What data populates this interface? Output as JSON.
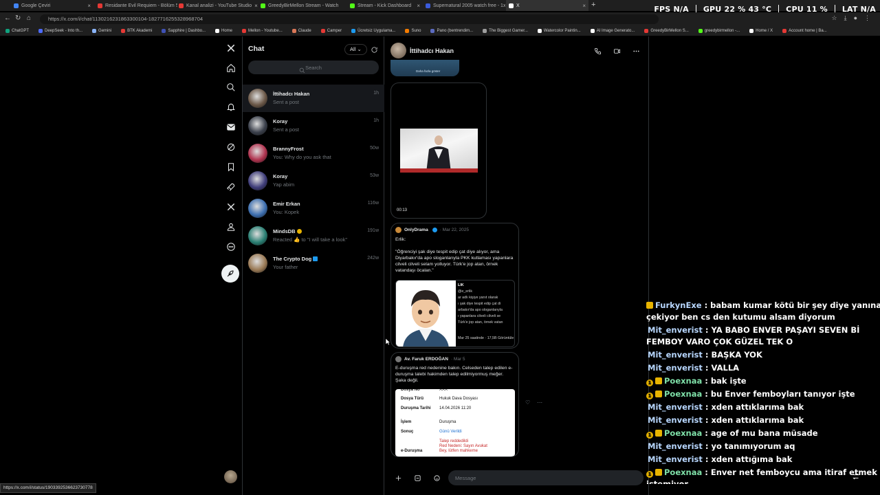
{
  "browser": {
    "tabs": [
      {
        "title": "Google Çeviri",
        "color": "#4285f4",
        "close": "×"
      },
      {
        "title": "Residante Evil Requiem - Bölüm 5",
        "color": "#e53935",
        "close": "×"
      },
      {
        "title": "Kanal analizi - YouTube Studio",
        "color": "#e53935",
        "close": "×"
      },
      {
        "title": "GreedyBirMellon Stream - Watch",
        "color": "#53fc18",
        "close": "×"
      },
      {
        "title": "Stream - Kick Dashboard",
        "color": "#53fc18",
        "close": "×"
      },
      {
        "title": "Supernatural 2005 watch free - 1x",
        "color": "#3b5bdb",
        "close": "×"
      },
      {
        "title": "X",
        "color": "#ffffff",
        "close": "×"
      }
    ],
    "new_tab": "+",
    "url": "https://x.com/i/chat/1130216231863300104-1827716255328968704",
    "bookmarks": [
      {
        "label": "ChatGPT",
        "color": "#10a37f"
      },
      {
        "label": "DeepSeek - Into th...",
        "color": "#4d6bfe"
      },
      {
        "label": "Gemini",
        "color": "#8ab4f8"
      },
      {
        "label": "BTK Akademi",
        "color": "#e53935"
      },
      {
        "label": "Sapphire | Dashbo...",
        "color": "#3f51b5"
      },
      {
        "label": "Home",
        "color": "#ffffff"
      },
      {
        "label": "Mellon - Youtube...",
        "color": "#e53935"
      },
      {
        "label": "Claude",
        "color": "#d97757"
      },
      {
        "label": "Camper",
        "color": "#e53935"
      },
      {
        "label": "Ücretsiz Uygulama...",
        "color": "#1d9bf0"
      },
      {
        "label": "Suno",
        "color": "#f57c00"
      },
      {
        "label": "Pano (bentrendim...",
        "color": "#5c6bc0"
      },
      {
        "label": "The Biggest Gamer...",
        "color": "#9e9e9e"
      },
      {
        "label": "Watercolor Paintin...",
        "color": "#ffffff"
      },
      {
        "label": "AI Image Generato...",
        "color": "#ffffff"
      },
      {
        "label": "GreedyBirMellon S...",
        "color": "#e53935"
      },
      {
        "label": "greedybirmellon -...",
        "color": "#53fc18"
      },
      {
        "label": "Home / X",
        "color": "#ffffff"
      },
      {
        "label": "Account home | Ba...",
        "color": "#e53935"
      }
    ]
  },
  "hud": {
    "fps_label": "FPS",
    "fps_value": "N/A",
    "gpu_label": "GPU",
    "gpu_value": "22 % 43 °C",
    "cpu_label": "CPU",
    "cpu_value": "11 %",
    "lat_label": "LAT",
    "lat_value": "N/A"
  },
  "chat": {
    "title": "Chat",
    "filter": "All",
    "search_placeholder": "Search",
    "conversations": [
      {
        "name": "İttihadcı Hakan",
        "preview": "Sent a post",
        "time": "1h",
        "avatar": "#6b5848"
      },
      {
        "name": "Koray",
        "preview": "Sent a post",
        "time": "1h",
        "avatar": "#3a3f4a"
      },
      {
        "name": "BrannyFrost",
        "preview": "You: Why do you ask that",
        "time": "50w",
        "avatar": "#b0334f"
      },
      {
        "name": "Koray",
        "preview": "Yap abim",
        "time": "53w",
        "avatar": "#3f3d7a"
      },
      {
        "name": "Emir Erkan",
        "preview": "You: Kopek",
        "time": "116w",
        "avatar": "#3d6fb0"
      },
      {
        "name": "MindsDB",
        "preview": "Reacted 👍 to \"I will take a look\"",
        "time": "191w",
        "avatar": "#2a7f73"
      },
      {
        "name": "The Crypto Dog",
        "preview": "Your father",
        "time": "242w",
        "avatar": "#9a7a56"
      }
    ]
  },
  "conversation": {
    "name": "İttihadcı Hakan",
    "quoted_card_button": "Daha fazla göster",
    "video_time": "00:13",
    "tweet1": {
      "author": "OnlyDrama",
      "date": "Mar 22, 2025",
      "text": "Erlik:\n\n\"Öğrenciyi şak diye tespit edip çat diye alıyor, ama Diyarbakır'da apo sloganlarıyla PKK kutlaması yapanlara cilveli cilveli selam yolluyor. Türk'e jop atan, örnek vatandaşı öcalan.\"",
      "quote_lines": [
        "LIK",
        "@e_erlik",
        "ar adlı kişiye yanıt olarak",
        "ı şak diye tespit edip çat di",
        "arbakır'da apo sloganlarıyla",
        "ı yapanlara cilveli cilveli se",
        "Türk'e jop atan, örnek vatan",
        "Mar 25 saatinde · 17,5B Görüntüle"
      ]
    },
    "tweet2": {
      "author": "Av. Faruk ERDOĞAN",
      "date": "Mar 5",
      "text": "E-duruşma red nedenine bakın. Celseden talep edilen e-duruşma talebi hakimden talep edilmiyormuş meğer. Şaka değil.",
      "doc": [
        {
          "k": "Dosya No",
          "v": "XXX"
        },
        {
          "k": "Dosya Türü",
          "v": "Hukuk Dava Dosyası"
        },
        {
          "k": "Duruşma Tarihi",
          "v": "14.04.2026 11:20"
        },
        {
          "k": "İşlem",
          "v": "Duruşma"
        },
        {
          "k": "Sonuç",
          "v": "Günü Verildi"
        },
        {
          "k": "e-Duruşma",
          "v": "Talep reddedildi",
          "v2": "Red Nedeni: Sayın Avukat",
          "v3": "Bey, lütfen mahkeme"
        }
      ]
    },
    "message_placeholder": "Message"
  },
  "kick_chat": [
    {
      "user": "FurkynExe",
      "text": ": babam kumar kötü bir şey diye yanına çekiyor ben cs den kutumu alsam diyorum",
      "badge": "gold"
    },
    {
      "user": "Mit_enverist",
      "text": ": YA BABO ENVER PAŞAYI SEVEN Bİ FEMBOY VARO ÇOK GÜZEL TEK O",
      "badge": ""
    },
    {
      "user": "Mit_enverist",
      "text": ": BAŞKA YOK",
      "badge": ""
    },
    {
      "user": "Mit_enverist",
      "text": ": VALLA",
      "badge": ""
    },
    {
      "user": "Poexnaa",
      "text": ": bak işte",
      "badge": "num"
    },
    {
      "user": "Poexnaa",
      "text": ": bu Enver femboyları tanıyor işte",
      "badge": "num"
    },
    {
      "user": "Mit_enverist",
      "text": ": xden attıklarıma bak",
      "badge": ""
    },
    {
      "user": "Mit_enverist",
      "text": ": xden attıklarıma bak",
      "badge": ""
    },
    {
      "user": "Poexnaa",
      "text": ": age of mu bana müsade",
      "badge": "num"
    },
    {
      "user": "Mit_enverist",
      "text": ": yo tanımıyorum aq",
      "badge": ""
    },
    {
      "user": "Mit_enverist",
      "text": ": xden attığıma bak",
      "badge": ""
    },
    {
      "user": "Poexnaa",
      "text": ": Enver net femboycu ama itiraf etmek istemiyor",
      "badge": "num"
    }
  ],
  "status_url": "https://x.com/i/status/1903392536623730778"
}
